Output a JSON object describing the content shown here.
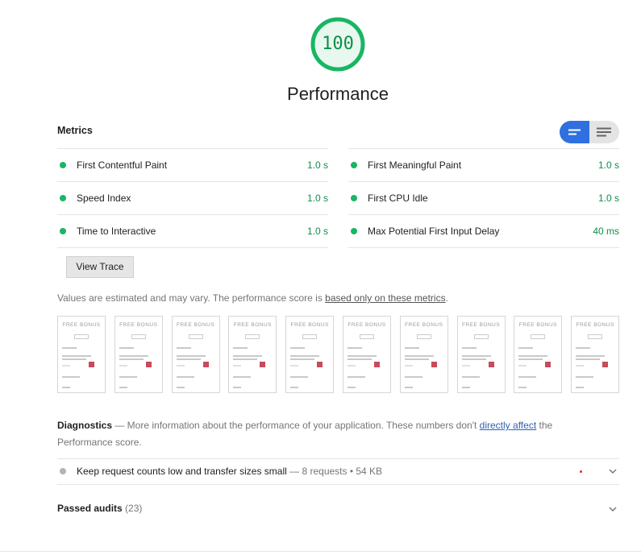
{
  "gauge": {
    "score": "100",
    "title": "Performance",
    "color": "#18b663"
  },
  "metrics": {
    "header": "Metrics",
    "left": [
      {
        "name": "First Contentful Paint",
        "value": "1.0 s"
      },
      {
        "name": "Speed Index",
        "value": "1.0 s"
      },
      {
        "name": "Time to Interactive",
        "value": "1.0 s"
      }
    ],
    "right": [
      {
        "name": "First Meaningful Paint",
        "value": "1.0 s"
      },
      {
        "name": "First CPU Idle",
        "value": "1.0 s"
      },
      {
        "name": "Max Potential First Input Delay",
        "value": "40 ms"
      }
    ],
    "view_trace": "View Trace",
    "toggle_icons": [
      "compact-view-icon",
      "expanded-view-icon"
    ]
  },
  "note": {
    "prefix": "Values are estimated and may vary. The performance score is ",
    "link": "based only on these metrics",
    "suffix": "."
  },
  "filmstrip": {
    "frame_title": "FREE BONUS",
    "frame_count": 10
  },
  "diagnostics": {
    "label": "Diagnostics",
    "text1": " — More information about the performance of your application. These numbers don't ",
    "link": "directly affect",
    "text2": " the Performance score.",
    "audits": [
      {
        "name": "Keep request counts low and transfer sizes small",
        "detail": " — 8 requests • 54 KB"
      }
    ]
  },
  "passed": {
    "label": "Passed audits",
    "count": "(23)"
  },
  "colors": {
    "pass": "#18b663",
    "pass_text": "#0c8f4a",
    "toggle_active": "#2f6fe0",
    "link": "#2f5fb3"
  }
}
